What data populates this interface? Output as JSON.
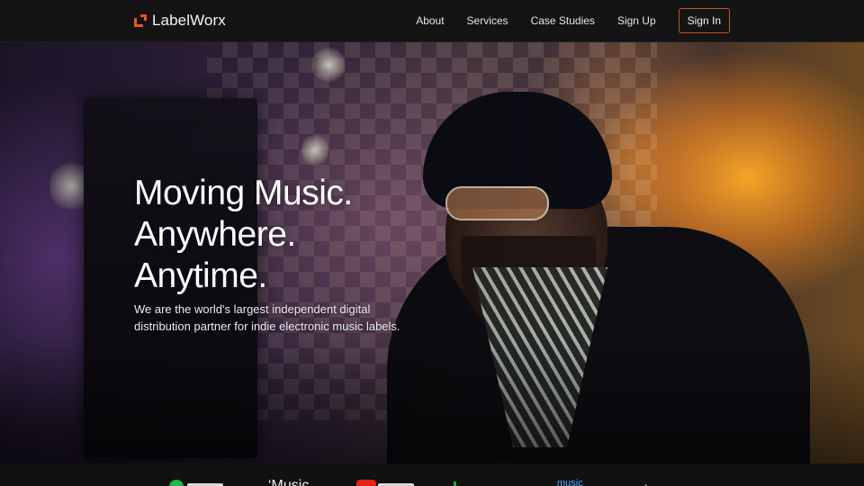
{
  "brand": {
    "name": "LabelWorx",
    "accent": "#e8551f"
  },
  "nav": {
    "links": [
      "About",
      "Services",
      "Case Studies",
      "Sign Up"
    ],
    "signin": "Sign In"
  },
  "hero": {
    "title_lines": [
      "Moving Music.",
      "Anywhere.",
      "Anytime."
    ],
    "subtitle": "We are the world's largest independent digital distribution partner for indie electronic music labels."
  },
  "partners": {
    "apple_glyph": "‘Music",
    "music_text": "music",
    "arrow_glyph": "›"
  }
}
